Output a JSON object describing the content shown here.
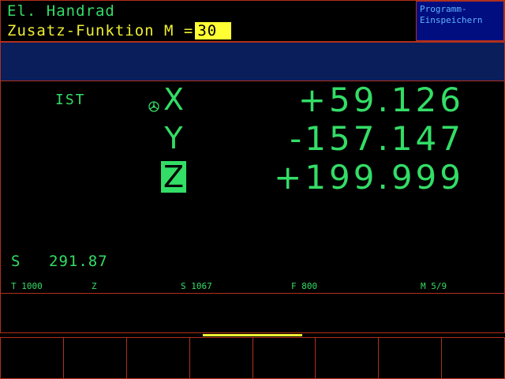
{
  "header": {
    "mode_title": "El. Handrad",
    "prompt_label": "Zusatz-Funktion M =",
    "prompt_value": "30",
    "softkey_top_label": "Programm-\nEinspeichern"
  },
  "position": {
    "label": "IST",
    "axes": [
      {
        "name": "X",
        "value": "+59.126"
      },
      {
        "name": "Y",
        "value": "-157.147"
      },
      {
        "name": "Z",
        "value": "+199.999"
      }
    ]
  },
  "spindle": {
    "label": "S",
    "value": "291.87"
  },
  "status": {
    "tool": "T 1000",
    "axis": "Z",
    "speed": "S 1067",
    "feed": "F 800",
    "mfunc": "M 5/9"
  },
  "colors": {
    "text_green": "#33dd66",
    "prompt_yellow": "#eeee33",
    "border_red": "#b0301c",
    "message_blue": "#0a1e5c",
    "softkey_blue": "#000e80"
  },
  "icons": {
    "handwheel": "handwheel-icon"
  }
}
